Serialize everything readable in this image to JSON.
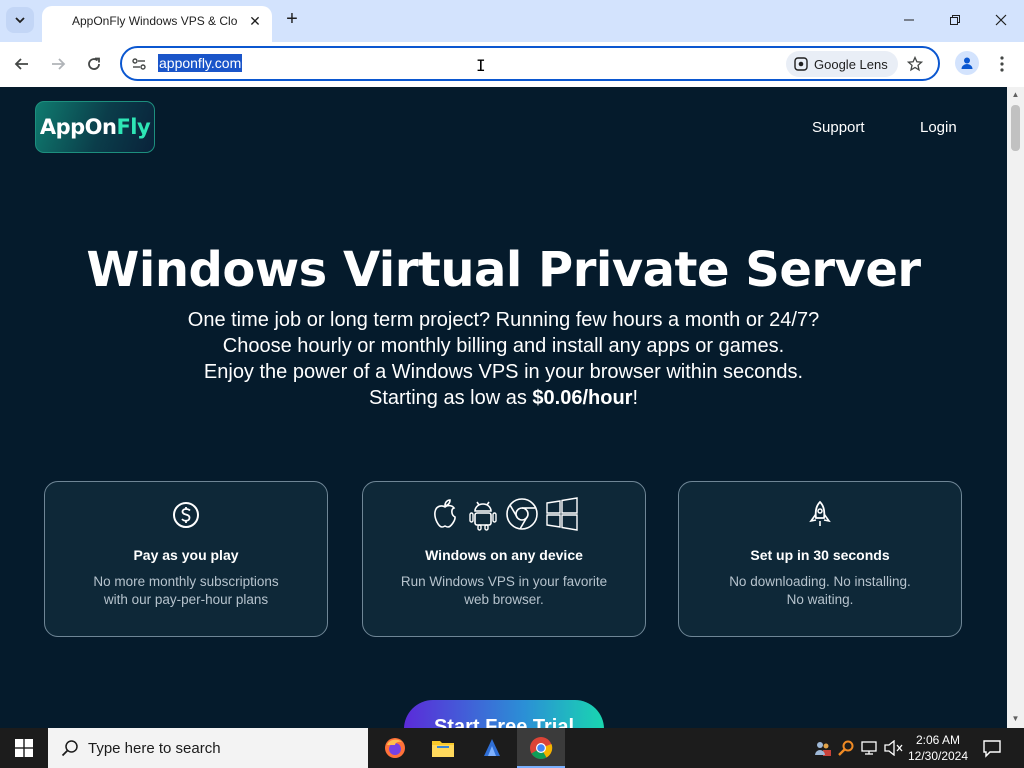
{
  "browser": {
    "tab_title": "AppOnFly Windows VPS & Clo",
    "url": "apponfly.com",
    "lens_label": "Google Lens"
  },
  "site": {
    "logo_part1": "AppOn",
    "logo_part2": "Fly",
    "nav": {
      "support": "Support",
      "login": "Login"
    },
    "hero": {
      "title": "Windows Virtual Private Server",
      "line1": "One time job or long term project? Running few hours a month or 24/7?",
      "line2": "Choose hourly or monthly billing and install any apps or games.",
      "line3": "Enjoy the power of a Windows VPS in your browser within seconds.",
      "line4_prefix": "Starting as low as ",
      "line4_price": "$0.06/hour",
      "line4_suffix": "!"
    },
    "cards": [
      {
        "title": "Pay as you play",
        "desc1": "No more monthly subscriptions",
        "desc2": "with our pay-per-hour plans"
      },
      {
        "title": "Windows on any device",
        "desc1": "Run Windows VPS in your favorite",
        "desc2": "web browser."
      },
      {
        "title": "Set up in 30 seconds",
        "desc1": "No downloading. No installing.",
        "desc2": "No waiting."
      }
    ],
    "cta": "Start Free Trial"
  },
  "taskbar": {
    "search_placeholder": "Type here to search",
    "time": "2:06 AM",
    "date": "12/30/2024"
  },
  "colors": {
    "page_bg": "#051b2c",
    "accent_teal": "#2ee6b6",
    "omnibox_focus": "#0b57d0",
    "tab_strip": "#d3e3fd"
  }
}
